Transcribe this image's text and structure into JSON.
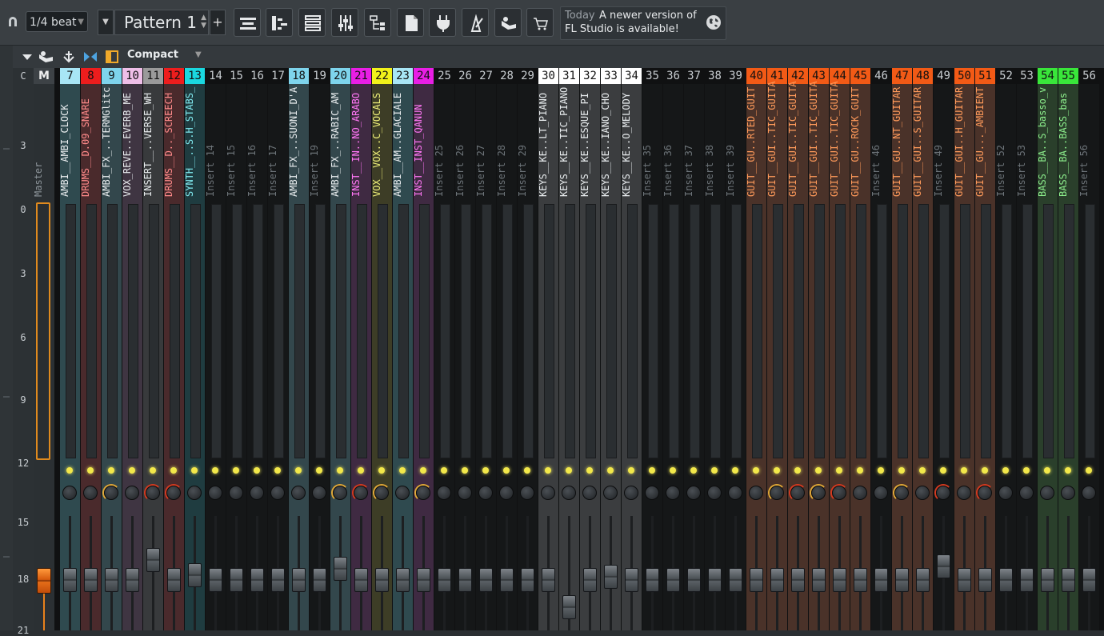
{
  "toolbar": {
    "snap_value": "1/4 beat",
    "pattern_label": "Pattern 1",
    "plus_label": "+",
    "hint": {
      "today": "Today",
      "line1": "A newer version of",
      "line2": "FL Studio is available!"
    },
    "buttons": [
      "playlist-icon",
      "piano-roll-icon",
      "channel-rack-icon",
      "mixer-icon",
      "browser-icon",
      "project-file-icon",
      "plugin-icon",
      "tempo-icon",
      "download-icon",
      "shop-icon"
    ]
  },
  "mixer_header": {
    "view_label": "Compact"
  },
  "scale": {
    "c_label": "C",
    "marks": [
      "3",
      "0",
      "3",
      "6",
      "9",
      "12",
      "15",
      "18",
      "21"
    ]
  },
  "master": {
    "header": "M",
    "name": "Master"
  },
  "colors": {
    "accent": "#e8811c",
    "led": "#f2e84a"
  },
  "tracks": [
    {
      "n": "7",
      "name": "AMBI__AMBI_CLOCK",
      "hdr": "#a8e6f5",
      "hdrText": "#111",
      "body": "#2f4a4f",
      "text": "#e8ecee",
      "knob": "",
      "fader": 0
    },
    {
      "n": "8",
      "name": "DRUMS__D.09_SNARE",
      "hdr": "#ee1d1d",
      "hdrText": "#111",
      "body": "#4a2a2c",
      "text": "#ff8a8a",
      "knob": "",
      "fader": 0
    },
    {
      "n": "9",
      "name": "AMBI_FX_..TERMGlitc",
      "hdr": "#7ed4ec",
      "hdrText": "#111",
      "body": "#33474c",
      "text": "#e8ecee",
      "knob": "#e0a838",
      "fader": 0
    },
    {
      "n": "10",
      "name": "VOX_REVE..EVERB_ME",
      "hdr": "#efbfe8",
      "hdrText": "#111",
      "body": "#3f3542",
      "text": "#e8ecee",
      "knob": "",
      "fader": 0
    },
    {
      "n": "11",
      "name": "INSERT__..VERSE_WH",
      "hdr": "#9a9a9a",
      "hdrText": "#111",
      "body": "#383a3c",
      "text": "#e8ecee",
      "knob": "#d43a20",
      "fader": -25
    },
    {
      "n": "12",
      "name": "DRUMS__D.._SCREECH",
      "hdr": "#ee1d1d",
      "hdrText": "#111",
      "body": "#4a2a2c",
      "text": "#ff8a8a",
      "knob": "#d43a20",
      "fader": 0
    },
    {
      "n": "13",
      "name": "SYNTH__..S.H_STABS_",
      "hdr": "#1ad8e0",
      "hdrText": "#111",
      "body": "#1f3c40",
      "text": "#7fe8ee",
      "knob": "",
      "fader": -6
    },
    {
      "n": "14",
      "name": "Insert 14",
      "hdr": "#101112",
      "hdrText": "#c8cdd1",
      "body": "#151718",
      "text": "#6c7378",
      "knob": "",
      "fader": 0
    },
    {
      "n": "15",
      "name": "Insert 15",
      "hdr": "#101112",
      "hdrText": "#c8cdd1",
      "body": "#151718",
      "text": "#6c7378",
      "knob": "",
      "fader": 0
    },
    {
      "n": "16",
      "name": "Insert 16",
      "hdr": "#101112",
      "hdrText": "#c8cdd1",
      "body": "#151718",
      "text": "#6c7378",
      "knob": "",
      "fader": 0
    },
    {
      "n": "17",
      "name": "Insert 17",
      "hdr": "#101112",
      "hdrText": "#c8cdd1",
      "body": "#151718",
      "text": "#6c7378",
      "knob": "",
      "fader": 0
    },
    {
      "n": "18",
      "name": "AMBI_FX_..SUONI_D'A",
      "hdr": "#7ed4ec",
      "hdrText": "#111",
      "body": "#33474c",
      "text": "#e8ecee",
      "knob": "",
      "fader": 0
    },
    {
      "n": "19",
      "name": "Insert 19",
      "hdr": "#101112",
      "hdrText": "#c8cdd1",
      "body": "#151718",
      "text": "#6c7378",
      "knob": "",
      "fader": 0
    },
    {
      "n": "20",
      "name": "AMBI_FX_..RABIC_AM",
      "hdr": "#7ed4ec",
      "hdrText": "#111",
      "body": "#33474c",
      "text": "#e8ecee",
      "knob": "#e0a838",
      "fader": -14
    },
    {
      "n": "21",
      "name": "INST__IN..NO_ARABO",
      "hdr": "#e91ee5",
      "hdrText": "#111",
      "body": "#3f2a42",
      "text": "#ff77f5",
      "knob": "#d43a20",
      "fader": 0
    },
    {
      "n": "22",
      "name": "VOX__VOX..C_VOCALS",
      "hdr": "#f2f21a",
      "hdrText": "#111",
      "body": "#3d3d26",
      "text": "#f0f07a",
      "knob": "#e0a838",
      "fader": 0
    },
    {
      "n": "23",
      "name": "AMBI__AM..GLACIALE",
      "hdr": "#a8e6f5",
      "hdrText": "#111",
      "body": "#2f4a4f",
      "text": "#e8ecee",
      "knob": "",
      "fader": 0
    },
    {
      "n": "24",
      "name": "INST__INST_QANUN",
      "hdr": "#e91ee5",
      "hdrText": "#111",
      "body": "#3f2a42",
      "text": "#ff77f5",
      "knob": "#e0a838",
      "fader": 0
    },
    {
      "n": "25",
      "name": "Insert 25",
      "hdr": "#101112",
      "hdrText": "#c8cdd1",
      "body": "#151718",
      "text": "#6c7378",
      "knob": "",
      "fader": 0
    },
    {
      "n": "26",
      "name": "Insert 26",
      "hdr": "#101112",
      "hdrText": "#c8cdd1",
      "body": "#151718",
      "text": "#6c7378",
      "knob": "",
      "fader": 0
    },
    {
      "n": "27",
      "name": "Insert 27",
      "hdr": "#101112",
      "hdrText": "#c8cdd1",
      "body": "#151718",
      "text": "#6c7378",
      "knob": "",
      "fader": 0
    },
    {
      "n": "28",
      "name": "Insert 28",
      "hdr": "#101112",
      "hdrText": "#c8cdd1",
      "body": "#151718",
      "text": "#6c7378",
      "knob": "",
      "fader": 0
    },
    {
      "n": "29",
      "name": "Insert 29",
      "hdr": "#101112",
      "hdrText": "#c8cdd1",
      "body": "#151718",
      "text": "#6c7378",
      "knob": "",
      "fader": 0
    },
    {
      "n": "30",
      "name": "KEYS__KE..LT_PIANO",
      "hdr": "#ffffff",
      "hdrText": "#111",
      "body": "#3b3d3f",
      "text": "#e8ecee",
      "knob": "",
      "fader": 0
    },
    {
      "n": "31",
      "name": "KEYS__KE..TIC_PIANO",
      "hdr": "#ffffff",
      "hdrText": "#111",
      "body": "#3b3d3f",
      "text": "#e8ecee",
      "knob": "",
      "fader": 34
    },
    {
      "n": "32",
      "name": "KEYS__KE..ESQUE_PI",
      "hdr": "#ffffff",
      "hdrText": "#111",
      "body": "#3b3d3f",
      "text": "#e8ecee",
      "knob": "",
      "fader": 0
    },
    {
      "n": "33",
      "name": "KEYS__KE..IANO_CHO",
      "hdr": "#ffffff",
      "hdrText": "#111",
      "body": "#3b3d3f",
      "text": "#e8ecee",
      "knob": "",
      "fader": -4
    },
    {
      "n": "34",
      "name": "KEYS__KE..O_MELODY",
      "hdr": "#ffffff",
      "hdrText": "#111",
      "body": "#3b3d3f",
      "text": "#e8ecee",
      "knob": "",
      "fader": 0
    },
    {
      "n": "35",
      "name": "Insert 35",
      "hdr": "#101112",
      "hdrText": "#c8cdd1",
      "body": "#151718",
      "text": "#6c7378",
      "knob": "",
      "fader": 0
    },
    {
      "n": "36",
      "name": "Insert 36",
      "hdr": "#101112",
      "hdrText": "#c8cdd1",
      "body": "#151718",
      "text": "#6c7378",
      "knob": "",
      "fader": 0
    },
    {
      "n": "37",
      "name": "Insert 37",
      "hdr": "#101112",
      "hdrText": "#c8cdd1",
      "body": "#151718",
      "text": "#6c7378",
      "knob": "",
      "fader": 0
    },
    {
      "n": "38",
      "name": "Insert 38",
      "hdr": "#101112",
      "hdrText": "#c8cdd1",
      "body": "#151718",
      "text": "#6c7378",
      "knob": "",
      "fader": 0
    },
    {
      "n": "39",
      "name": "Insert 39",
      "hdr": "#101112",
      "hdrText": "#c8cdd1",
      "body": "#151718",
      "text": "#6c7378",
      "knob": "",
      "fader": 0
    },
    {
      "n": "40",
      "name": "GUIT__GU..RTED_GUIT",
      "hdr": "#f25a16",
      "hdrText": "#111",
      "body": "#4a3229",
      "text": "#ff9a5a",
      "knob": "",
      "fader": 0
    },
    {
      "n": "41",
      "name": "GUIT__GUI..TIC_GUITA",
      "hdr": "#f25a16",
      "hdrText": "#111",
      "body": "#4a3229",
      "text": "#ff9a5a",
      "knob": "#e0a838",
      "fader": 0
    },
    {
      "n": "42",
      "name": "GUIT__GUI..TIC_GUITA",
      "hdr": "#f25a16",
      "hdrText": "#111",
      "body": "#4a3229",
      "text": "#ff9a5a",
      "knob": "#d43a20",
      "fader": 0
    },
    {
      "n": "43",
      "name": "GUIT__GUI..TIC_GUITA",
      "hdr": "#f25a16",
      "hdrText": "#111",
      "body": "#4a3229",
      "text": "#ff9a5a",
      "knob": "#e0a838",
      "fader": 0
    },
    {
      "n": "44",
      "name": "GUIT__GUI..TIC_GUITA",
      "hdr": "#f25a16",
      "hdrText": "#111",
      "body": "#4a3229",
      "text": "#ff9a5a",
      "knob": "#d43a20",
      "fader": 0
    },
    {
      "n": "45",
      "name": "GUIT__GU..ROCK_GUIT",
      "hdr": "#f25a16",
      "hdrText": "#111",
      "body": "#4a3229",
      "text": "#ff9a5a",
      "knob": "",
      "fader": 0
    },
    {
      "n": "46",
      "name": "Insert 46",
      "hdr": "#101112",
      "hdrText": "#c8cdd1",
      "body": "#151718",
      "text": "#6c7378",
      "knob": "",
      "fader": 0
    },
    {
      "n": "47",
      "name": "GUIT__GU..NT_GUITAR",
      "hdr": "#f25a16",
      "hdrText": "#111",
      "body": "#4a3229",
      "text": "#ff9a5a",
      "knob": "#e0a838",
      "fader": 0
    },
    {
      "n": "48",
      "name": "GUIT__GUI..S_GUITAR",
      "hdr": "#f25a16",
      "hdrText": "#111",
      "body": "#4a3229",
      "text": "#ff9a5a",
      "knob": "",
      "fader": 0
    },
    {
      "n": "49",
      "name": "Insert 49",
      "hdr": "#101112",
      "hdrText": "#c8cdd1",
      "body": "#151718",
      "text": "#6c7378",
      "knob": "#d43a20",
      "fader": -17
    },
    {
      "n": "50",
      "name": "GUIT__GUI..H_GUITAR",
      "hdr": "#f25a16",
      "hdrText": "#111",
      "body": "#4a3229",
      "text": "#ff9a5a",
      "knob": "",
      "fader": 0
    },
    {
      "n": "51",
      "name": "GUIT__GU..._AMBIENT",
      "hdr": "#f25a16",
      "hdrText": "#111",
      "body": "#4a3229",
      "text": "#ff9a5a",
      "knob": "#d43a20",
      "fader": 0
    },
    {
      "n": "52",
      "name": "Insert 52",
      "hdr": "#101112",
      "hdrText": "#c8cdd1",
      "body": "#151718",
      "text": "#6c7378",
      "knob": "",
      "fader": 0
    },
    {
      "n": "53",
      "name": "Insert 53",
      "hdr": "#101112",
      "hdrText": "#c8cdd1",
      "body": "#151718",
      "text": "#6c7378",
      "knob": "",
      "fader": 0
    },
    {
      "n": "54",
      "name": "BASS__BA..S_basso_v",
      "hdr": "#39e63a",
      "hdrText": "#111",
      "body": "#2a3f2b",
      "text": "#8df08d",
      "knob": "",
      "fader": 0
    },
    {
      "n": "55",
      "name": "BASS__BA..BASS_bas",
      "hdr": "#39e63a",
      "hdrText": "#111",
      "body": "#2a3f2b",
      "text": "#8df08d",
      "knob": "",
      "fader": 0
    },
    {
      "n": "56",
      "name": "Insert 56",
      "hdr": "#101112",
      "hdrText": "#c8cdd1",
      "body": "#151718",
      "text": "#6c7378",
      "knob": "",
      "fader": 0
    }
  ]
}
